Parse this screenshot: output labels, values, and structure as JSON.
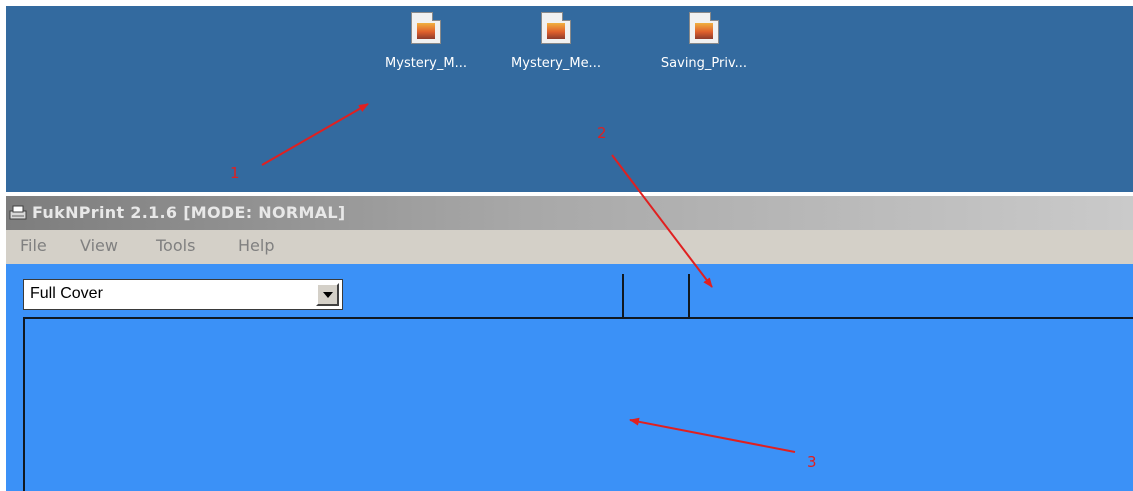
{
  "desktop": {
    "icons": [
      {
        "label": "Mystery_M..."
      },
      {
        "label": "Mystery_Me..."
      },
      {
        "label": "Saving_Priv..."
      }
    ]
  },
  "window": {
    "title": "FukNPrint 2.1.6 [MODE: NORMAL]"
  },
  "menubar": {
    "items": [
      "File",
      "View",
      "Tools",
      "Help"
    ]
  },
  "toolbar": {
    "mode_select_value": "Full Cover"
  },
  "annotations": [
    "1",
    "2",
    "3"
  ],
  "colors": {
    "desktop_bg": "#336a9f",
    "client_bg": "#3b91f7",
    "annotation": "#e02020"
  }
}
